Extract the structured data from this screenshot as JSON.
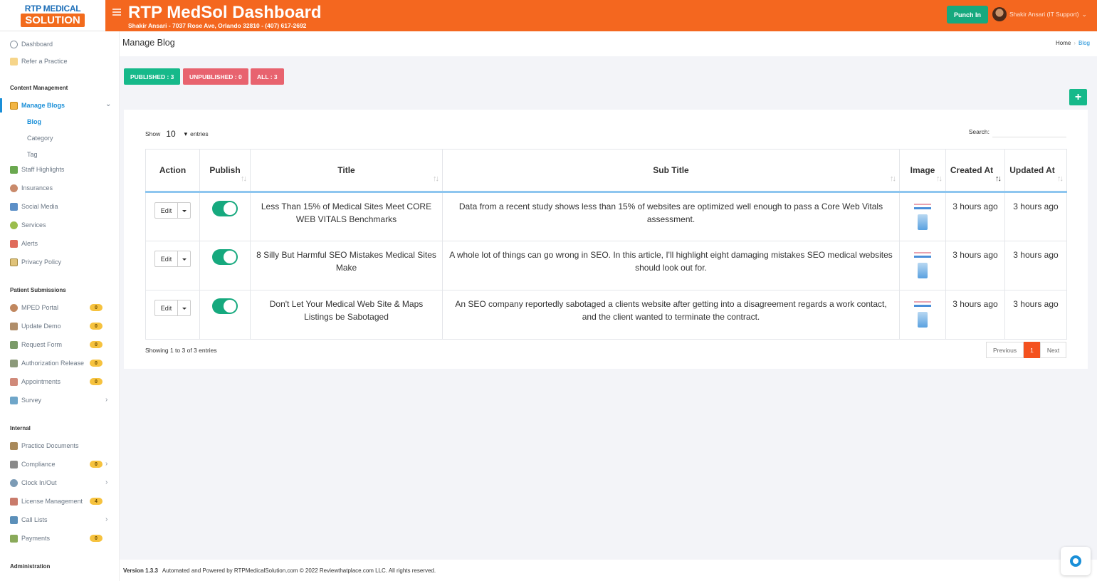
{
  "brand": {
    "logo_top": "RTP MEDICAL",
    "logo_bottom": "SOLUTION"
  },
  "header": {
    "title": "RTP MedSol Dashboard",
    "subtitle": "Shakir Ansari - 7037 Rose Ave, Orlando 32810 - (407) 617-2692",
    "punch_label": "Punch In",
    "user_label": "Shakir Ansari (IT Support)"
  },
  "sidebar": {
    "top": [
      {
        "label": "Dashboard",
        "icon": "dashboard-icon"
      },
      {
        "label": "Refer a Practice",
        "icon": "refer-icon"
      }
    ],
    "sections": {
      "content": "Content Management",
      "patient": "Patient Submissions",
      "internal": "Internal",
      "admin": "Administration"
    },
    "manage_blogs": "Manage Blogs",
    "blog_sub": [
      "Blog",
      "Category",
      "Tag"
    ],
    "content_items": [
      "Staff Highlights",
      "Insurances",
      "Social Media",
      "Services",
      "Alerts",
      "Privacy Policy"
    ],
    "patient_items": [
      {
        "label": "MPED Portal",
        "badge": "0"
      },
      {
        "label": "Update Demo",
        "badge": "0"
      },
      {
        "label": "Request Form",
        "badge": "0"
      },
      {
        "label": "Authorization Release",
        "badge": "0"
      },
      {
        "label": "Appointments",
        "badge": "0"
      },
      {
        "label": "Survey",
        "badge": ""
      }
    ],
    "internal_items": [
      {
        "label": "Practice Documents",
        "badge": ""
      },
      {
        "label": "Compliance",
        "badge": "0"
      },
      {
        "label": "Clock In/Out",
        "badge": ""
      },
      {
        "label": "License Management",
        "badge": "4"
      },
      {
        "label": "Call Lists",
        "badge": ""
      },
      {
        "label": "Payments",
        "badge": "0"
      }
    ]
  },
  "page": {
    "title": "Manage Blog",
    "breadcrumb": [
      "Home",
      "Blog"
    ]
  },
  "filters": {
    "published": "PUBLISHED : 3",
    "unpublished": "UNPUBLISHED : 0",
    "all": "ALL : 3"
  },
  "add_label": "+",
  "table_controls": {
    "show": "Show",
    "entries_value": "10",
    "entries": "entries",
    "search": "Search:",
    "info": "Showing 1 to 3 of 3 entries",
    "prev": "Previous",
    "page": "1",
    "next": "Next"
  },
  "table": {
    "headers": [
      "Action",
      "Publish",
      "Title",
      "Sub Title",
      "Image",
      "Created At",
      "Updated At"
    ],
    "edit_label": "Edit",
    "rows": [
      {
        "title": "Less Than 15% of Medical Sites Meet CORE WEB VITALS Benchmarks",
        "subtitle": "Data from a recent study shows less than 15% of websites are optimized well enough to pass a Core Web Vitals assessment.",
        "created": "3 hours ago",
        "updated": "3 hours ago"
      },
      {
        "title": "8 Silly But Harmful SEO Mistakes Medical Sites Make",
        "subtitle": "A whole lot of things can go wrong in SEO. In this article, I'll highlight eight damaging mistakes SEO medical websites should look out for.",
        "created": "3 hours ago",
        "updated": "3 hours ago"
      },
      {
        "title": "Don't Let Your Medical Web Site & Maps Listings be Sabotaged",
        "subtitle": "An SEO company reportedly sabotaged a clients website after getting into a disagreement regards a work contact, and the client wanted to terminate the contract.",
        "created": "3 hours ago",
        "updated": "3 hours ago"
      }
    ]
  },
  "footer": {
    "version": "Version 1.3.3",
    "text": "Automated and Powered by RTPMedicalSolution.com © 2022 Reviewthatplace.com LLC. All rights reserved."
  },
  "colors": {
    "header": "#f4671f",
    "accent": "#1a8fd8",
    "green": "#16b98a",
    "red": "#e8636f"
  }
}
